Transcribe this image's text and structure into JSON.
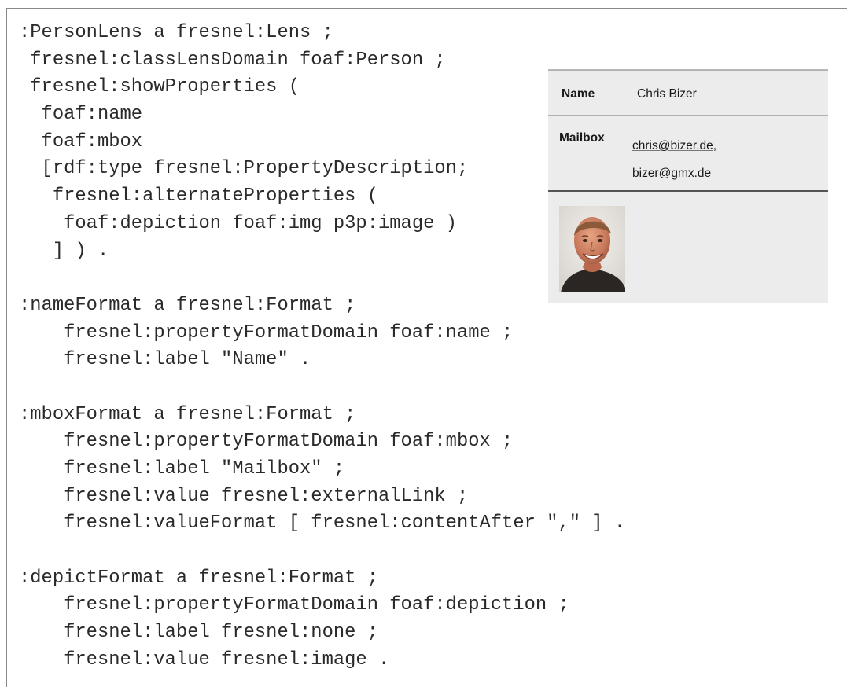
{
  "code_lines": [
    ":PersonLens a fresnel:Lens ;",
    " fresnel:classLensDomain foaf:Person ;",
    " fresnel:showProperties (",
    "  foaf:name",
    "  foaf:mbox",
    "  [rdf:type fresnel:PropertyDescription;",
    "   fresnel:alternateProperties (",
    "    foaf:depiction foaf:img p3p:image )",
    "   ] ) .",
    "",
    ":nameFormat a fresnel:Format ;",
    "    fresnel:propertyFormatDomain foaf:name ;",
    "    fresnel:label \"Name\" .",
    "",
    ":mboxFormat a fresnel:Format ;",
    "    fresnel:propertyFormatDomain foaf:mbox ;",
    "    fresnel:label \"Mailbox\" ;",
    "    fresnel:value fresnel:externalLink ;",
    "    fresnel:valueFormat [ fresnel:contentAfter \",\" ] .",
    "",
    ":depictFormat a fresnel:Format ;",
    "    fresnel:propertyFormatDomain foaf:depiction ;",
    "    fresnel:label fresnel:none ;",
    "    fresnel:value fresnel:image ."
  ],
  "rendered_view": {
    "name_label": "Name",
    "name_value": "Chris Bizer",
    "mailbox_label": "Mailbox",
    "mailbox_1": "chris@bizer.de",
    "mailbox_separator": ",",
    "mailbox_2": "bizer@gmx.de"
  }
}
